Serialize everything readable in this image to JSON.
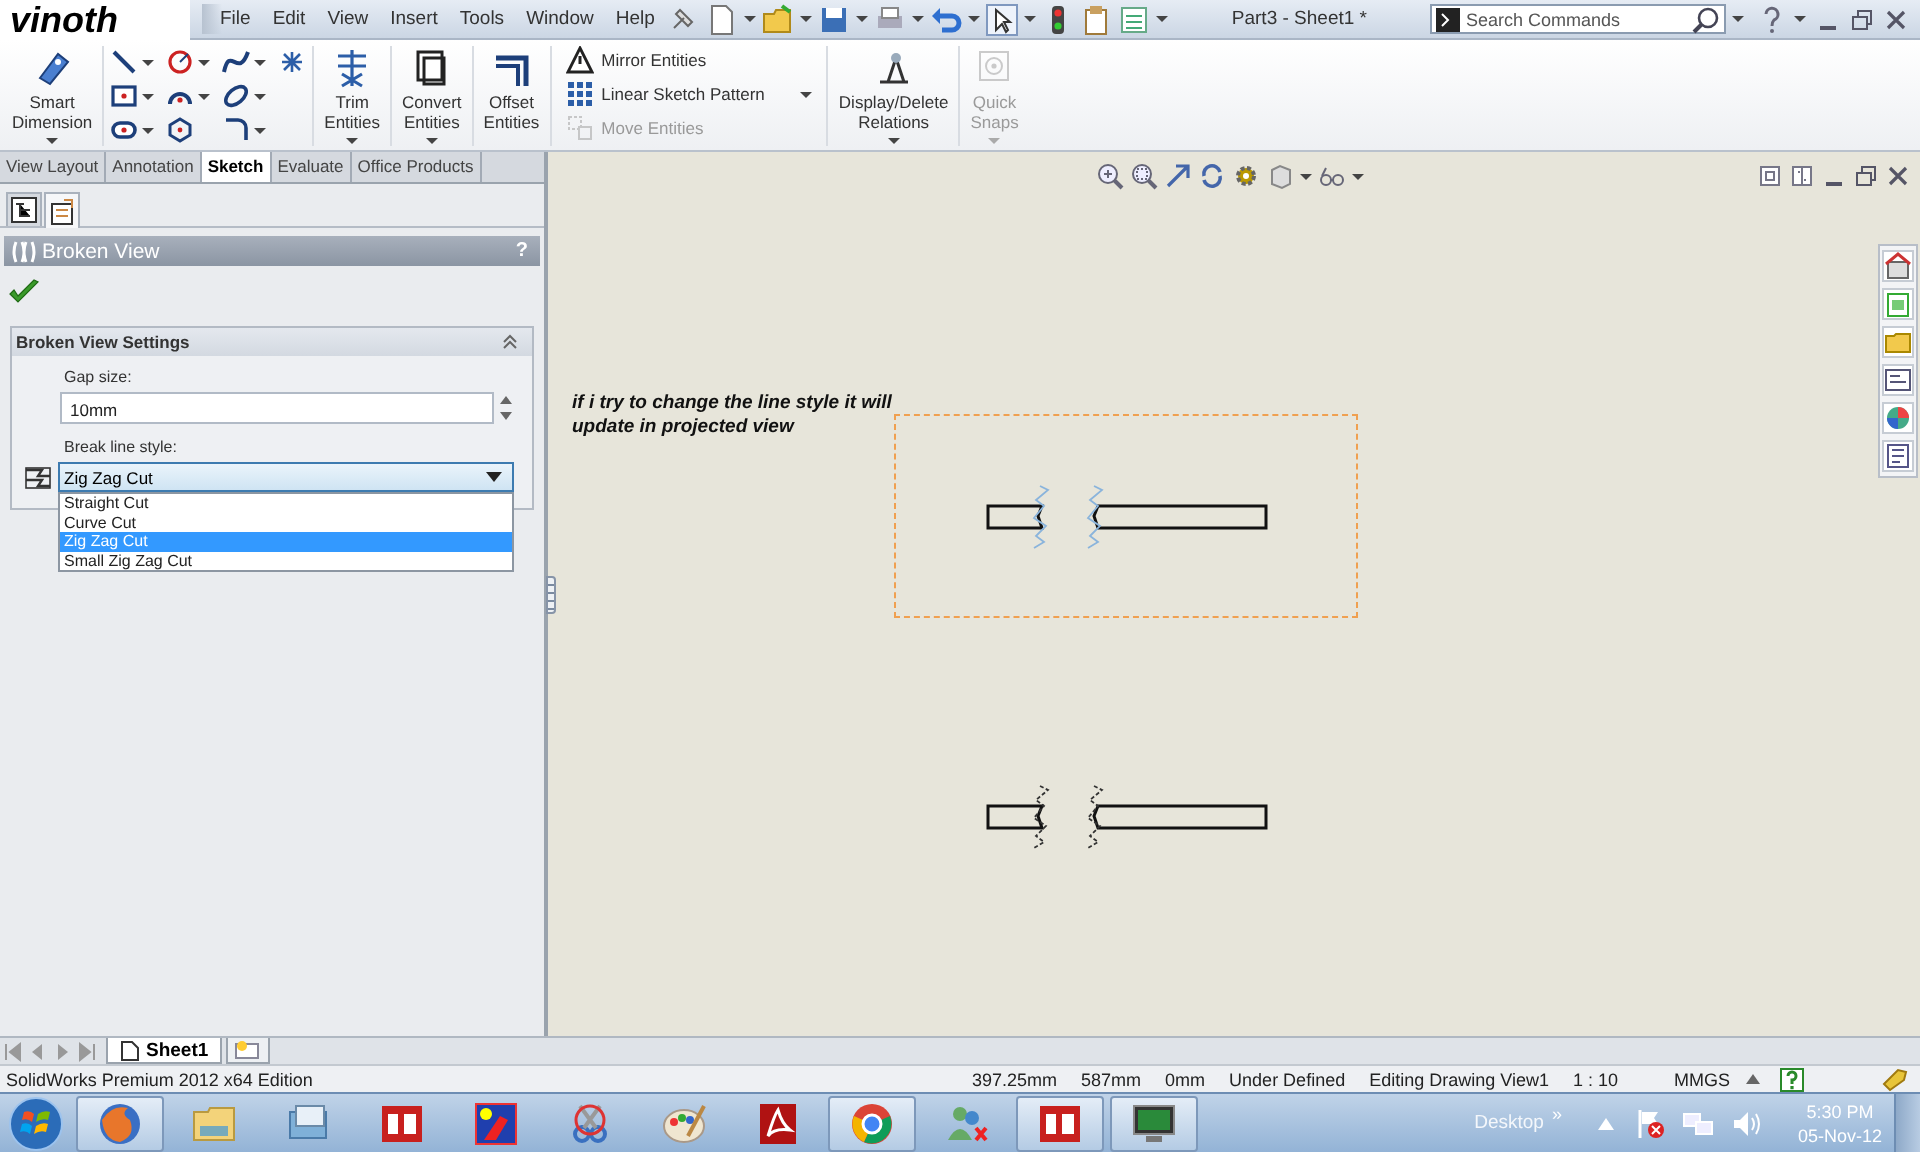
{
  "title_bar": {
    "logo": "vinoth",
    "menu": [
      "File",
      "Edit",
      "View",
      "Insert",
      "Tools",
      "Window",
      "Help"
    ],
    "title": "Part3 - Sheet1 *",
    "search": {
      "placeholder": "Search Commands"
    }
  },
  "ribbon": [
    {
      "kind": "large",
      "label": "Smart\nDimension",
      "menu": true,
      "disabled": false
    },
    {
      "kind": "sketch_grid"
    },
    {
      "kind": "large",
      "label": "Trim\nEntities",
      "menu": true,
      "disabled": false
    },
    {
      "kind": "large",
      "label": "Convert\nEntities",
      "menu": true,
      "disabled": false
    },
    {
      "kind": "large",
      "label": "Offset\nEntities",
      "menu": false,
      "disabled": false
    },
    {
      "kind": "stack",
      "items": [
        {
          "label": "Mirror Entities",
          "disabled": false
        },
        {
          "label": "Linear Sketch Pattern",
          "disabled": false
        },
        {
          "label": "Move Entities",
          "disabled": true
        }
      ]
    },
    {
      "kind": "large",
      "label": "Display/Delete\nRelations",
      "menu": true,
      "disabled": false
    },
    {
      "kind": "large",
      "label": "Quick\nSnaps",
      "menu": true,
      "disabled": true
    }
  ],
  "command_tabs": [
    {
      "label": "View Layout",
      "selected": false
    },
    {
      "label": "Annotation",
      "selected": false
    },
    {
      "label": "Sketch",
      "selected": true
    },
    {
      "label": "Evaluate",
      "selected": false
    },
    {
      "label": "Office Products",
      "selected": false
    }
  ],
  "property_manager": {
    "tabs": [
      {
        "selected": false
      },
      {
        "selected": true
      }
    ],
    "title": "Broken View",
    "help": "?",
    "group": {
      "title": "Broken View Settings",
      "expanded": true,
      "gap_label": "Gap size:",
      "gap_value": "10mm",
      "style_label": "Break line style:",
      "style": {
        "value": "Zig Zag Cut",
        "expanded": true,
        "options": [
          {
            "label": "Straight Cut",
            "selected": false
          },
          {
            "label": "Curve Cut",
            "selected": false
          },
          {
            "label": "Zig Zag Cut",
            "selected": true
          },
          {
            "label": "Small Zig Zag Cut",
            "selected": false
          }
        ]
      }
    }
  },
  "canvas": {
    "note": "if i try to change the line style it will update in projected view",
    "views": [
      {
        "selected": true
      },
      {
        "selected": false
      }
    ]
  },
  "sheet_tabs": [
    {
      "label": "Sheet1",
      "selected": true
    }
  ],
  "status_bar": {
    "product": "SolidWorks Premium 2012 x64 Edition",
    "fields": [
      "397.25mm",
      "587mm",
      "0mm",
      "Under Defined",
      "Editing Drawing View1",
      "1 : 10"
    ],
    "units": "MMGS"
  },
  "taskbar": {
    "apps": [
      {
        "running": true
      },
      {
        "running": false
      },
      {
        "running": false
      },
      {
        "running": false
      },
      {
        "running": false
      },
      {
        "running": false
      },
      {
        "running": false
      },
      {
        "running": false
      },
      {
        "running": true
      },
      {
        "running": false
      },
      {
        "running": true
      },
      {
        "running": true
      }
    ],
    "desktop": "Desktop",
    "overflow": "»",
    "time": "5:30 PM",
    "date": "05-Nov-12"
  }
}
